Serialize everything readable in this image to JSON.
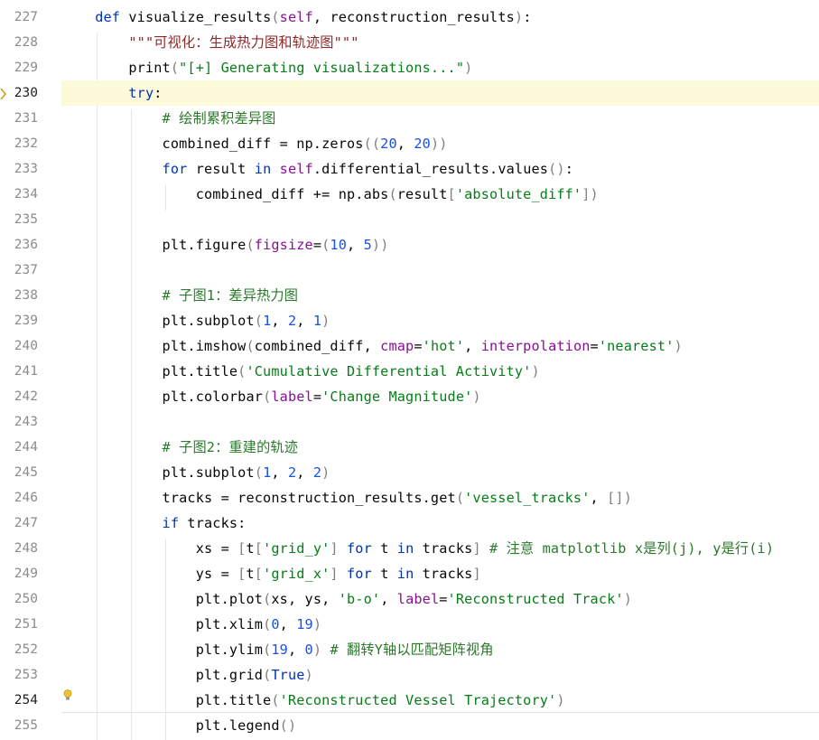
{
  "editor": {
    "language": "python",
    "current_line": 230,
    "caret_line": 254,
    "lines": [
      {
        "n": "227",
        "text": "    def visualize_results(self, reconstruction_results):"
      },
      {
        "n": "228",
        "text": "        \"\"\"可视化：生成热力图和轨迹图\"\"\""
      },
      {
        "n": "229",
        "text": "        print(\"[+] Generating visualizations...\")"
      },
      {
        "n": "230",
        "text": "        try:"
      },
      {
        "n": "231",
        "text": "            # 绘制累积差异图"
      },
      {
        "n": "232",
        "text": "            combined_diff = np.zeros((20, 20))"
      },
      {
        "n": "233",
        "text": "            for result in self.differential_results.values():"
      },
      {
        "n": "234",
        "text": "                combined_diff += np.abs(result['absolute_diff'])"
      },
      {
        "n": "235",
        "text": ""
      },
      {
        "n": "236",
        "text": "            plt.figure(figsize=(10, 5))"
      },
      {
        "n": "237",
        "text": ""
      },
      {
        "n": "238",
        "text": "            # 子图1：差异热力图"
      },
      {
        "n": "239",
        "text": "            plt.subplot(1, 2, 1)"
      },
      {
        "n": "240",
        "text": "            plt.imshow(combined_diff, cmap='hot', interpolation='nearest')"
      },
      {
        "n": "241",
        "text": "            plt.title('Cumulative Differential Activity')"
      },
      {
        "n": "242",
        "text": "            plt.colorbar(label='Change Magnitude')"
      },
      {
        "n": "243",
        "text": ""
      },
      {
        "n": "244",
        "text": "            # 子图2：重建的轨迹"
      },
      {
        "n": "245",
        "text": "            plt.subplot(1, 2, 2)"
      },
      {
        "n": "246",
        "text": "            tracks = reconstruction_results.get('vessel_tracks', [])"
      },
      {
        "n": "247",
        "text": "            if tracks:"
      },
      {
        "n": "248",
        "text": "                xs = [t['grid_y'] for t in tracks] # 注意 matplotlib x是列(j), y是行(i)"
      },
      {
        "n": "249",
        "text": "                ys = [t['grid_x'] for t in tracks]"
      },
      {
        "n": "250",
        "text": "                plt.plot(xs, ys, 'b-o', label='Reconstructed Track')"
      },
      {
        "n": "251",
        "text": "                plt.xlim(0, 19)"
      },
      {
        "n": "252",
        "text": "                plt.ylim(19, 0) # 翻转Y轴以匹配矩阵视角"
      },
      {
        "n": "253",
        "text": "                plt.grid(True)"
      },
      {
        "n": "254",
        "text": "                plt.title('Reconstructed Vessel Trajectory')"
      },
      {
        "n": "255",
        "text": "                plt.legend()"
      }
    ]
  },
  "icons": {
    "breakpoint_marker": "chevron-right-icon",
    "intention": "lightbulb-icon"
  },
  "colors": {
    "keyword": "#0033b3",
    "string": "#067d17",
    "number": "#1750eb",
    "comment": "#8c8c8c",
    "docstring": "#8c2a2a",
    "current_line_bg": "#fcfad9",
    "bulb": "#e8b400"
  }
}
